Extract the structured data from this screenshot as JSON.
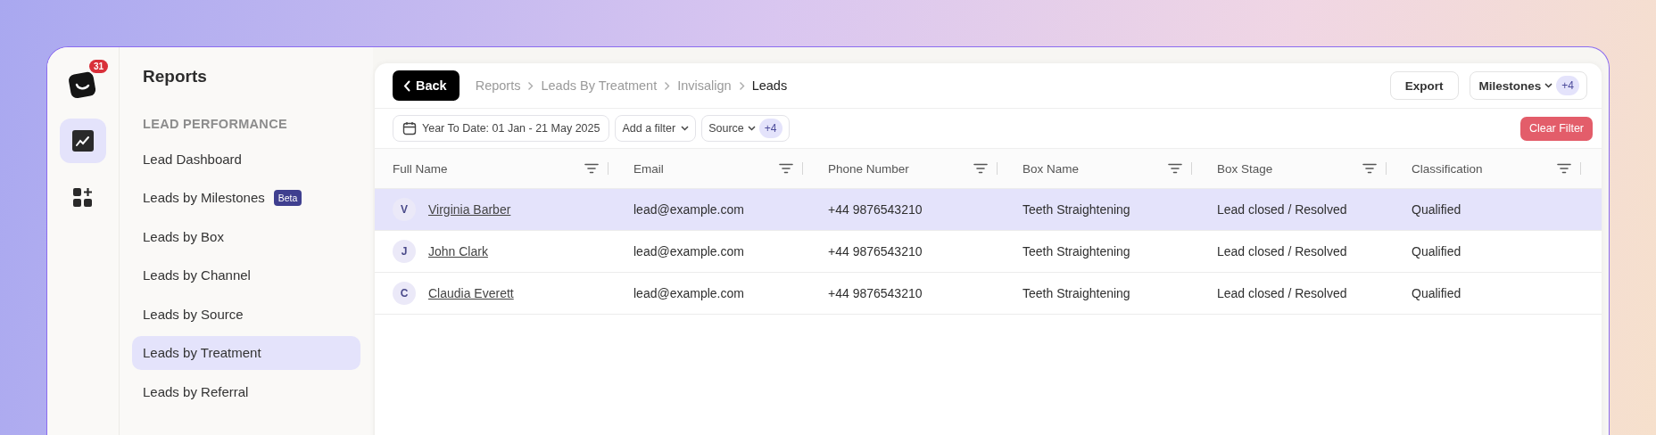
{
  "app": {
    "notification_count": "31"
  },
  "rail": [
    {
      "kind": "reports",
      "selected": true
    },
    {
      "kind": "apps",
      "selected": false
    }
  ],
  "sidebar": {
    "title": "Reports",
    "section": "LEAD PERFORMANCE",
    "items": [
      {
        "label": "Lead Dashboard",
        "selected": false
      },
      {
        "label": "Leads by Milestones",
        "badge": "Beta",
        "selected": false
      },
      {
        "label": "Leads by Box",
        "selected": false
      },
      {
        "label": "Leads by Channel",
        "selected": false
      },
      {
        "label": "Leads by Source",
        "selected": false
      },
      {
        "label": "Leads by Treatment",
        "selected": true
      },
      {
        "label": "Leads by Referral",
        "selected": false
      }
    ]
  },
  "header": {
    "back": "Back",
    "breadcrumb": [
      {
        "label": "Reports",
        "current": false
      },
      {
        "label": "Leads By Treatment",
        "current": false
      },
      {
        "label": "Invisalign",
        "current": false
      },
      {
        "label": "Leads",
        "current": true
      }
    ],
    "export": "Export",
    "milestones": {
      "label": "Milestones",
      "count": "+4"
    }
  },
  "filters": {
    "date": "Year To Date: 01 Jan - 21 May 2025",
    "add": "Add a filter",
    "source": {
      "label": "Source",
      "count": "+4"
    },
    "clear": "Clear Filter"
  },
  "table": {
    "columns": [
      "Full Name",
      "Email",
      "Phone Number",
      "Box Name",
      "Box Stage",
      "Classification"
    ],
    "rows": [
      {
        "initial": "V",
        "selected": true,
        "cells": [
          "Virginia Barber",
          "lead@example.com",
          "+44 9876543210",
          "Teeth Straightening",
          "Lead closed / Resolved",
          "Qualified"
        ]
      },
      {
        "initial": "J",
        "selected": false,
        "cells": [
          "John Clark",
          "lead@example.com",
          "+44 9876543210",
          "Teeth Straightening",
          "Lead closed / Resolved",
          "Qualified"
        ]
      },
      {
        "initial": "C",
        "selected": false,
        "cells": [
          "Claudia Everett",
          "lead@example.com",
          "+44 9876543210",
          "Teeth Straightening",
          "Lead closed / Resolved",
          "Qualified"
        ]
      }
    ]
  }
}
